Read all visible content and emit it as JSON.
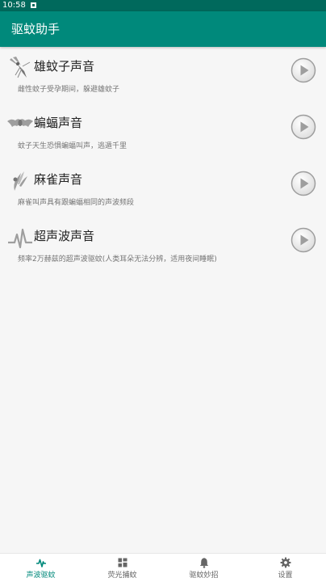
{
  "status_bar": {
    "time": "10:58"
  },
  "app_bar": {
    "title": "驱蚊助手"
  },
  "sounds": [
    {
      "title": "雄蚊子声音",
      "description": "雌性蚊子受孕期间，躲避雄蚊子",
      "icon": "mosquito-icon"
    },
    {
      "title": "蝙蝠声音",
      "description": "蚊子天生恐惧蝙蝠叫声，逃遁千里",
      "icon": "bat-icon"
    },
    {
      "title": "麻雀声音",
      "description": "麻雀叫声具有跟蝙蝠相同的声波频段",
      "icon": "sparrow-icon"
    },
    {
      "title": "超声波声音",
      "description": "频率2万赫兹的超声波驱蚊(人类耳朵无法分辨，适用夜间睡眠)",
      "icon": "ultrasonic-wave-icon"
    }
  ],
  "bottom_nav": [
    {
      "label": "声波驱蚊",
      "icon": "pulse-icon",
      "active": true
    },
    {
      "label": "荧光捕蚊",
      "icon": "grid-icon",
      "active": false
    },
    {
      "label": "驱蚊妙招",
      "icon": "bell-icon",
      "active": false
    },
    {
      "label": "设置",
      "icon": "gear-icon",
      "active": false
    }
  ],
  "colors": {
    "primary": "#00897b",
    "status_bar": "#00695c",
    "background": "#f6f6f6",
    "active_nav": "#00897b"
  }
}
